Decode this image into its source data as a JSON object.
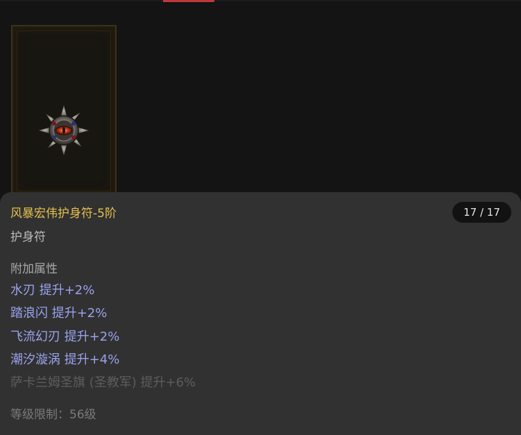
{
  "item": {
    "name": "风暴宏伟护身符-5阶",
    "count": "17 / 17",
    "type": "护身符",
    "affix_section_title": "附加属性",
    "affixes": [
      {
        "text": "水刃 提升+2%"
      },
      {
        "text": "踏浪闪 提升+2%"
      },
      {
        "text": "飞流幻刃 提升+2%"
      },
      {
        "text": "潮汐漩涡 提升+4%"
      },
      {
        "text": "萨卡兰姆圣旗 (圣教军) 提升+6%"
      }
    ],
    "level_requirement": "等级限制：56级"
  },
  "icon": "amulet-icon",
  "colors": {
    "name": "#e6c24e",
    "affix_active": "#9aa2ee",
    "affix_inactive": "#5d5d5d",
    "tab_indicator": "#c0383c"
  }
}
